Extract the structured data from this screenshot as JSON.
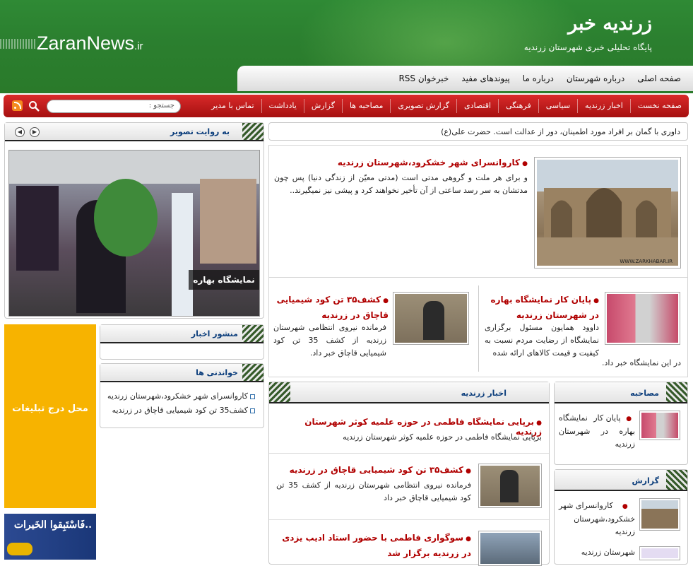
{
  "header": {
    "brand_fa": "زرندیه خبر",
    "subtitle": "پایگاه تحلیلی خبری شهرستان زرندیه",
    "brand_en": "ZaranNews",
    "brand_en_suffix": ".ir"
  },
  "topnav": [
    "صفحه اصلی",
    "درباره شهرستان",
    "درباره ما",
    "پیوندهای مفید",
    "خبرخوان RSS"
  ],
  "mainmenu": [
    "صفحه نخست",
    "اخبار زرندیه",
    "سیاسی",
    "فرهنگی",
    "اقتصادی",
    "گزارش تصویری",
    "مصاحبه ها",
    "گزارش",
    "یادداشت",
    "تماس با مدیر"
  ],
  "search": {
    "placeholder": "جستجو :"
  },
  "quote": "داوری با گمان بر افراد مورد اطمینان، دور از عدالت است. حضرت علی(ع)",
  "featured": {
    "title": "کاروانسرای شهر خشکرود،شهرستان زرندیه",
    "body": "و برای هر ملت و گروهی مدتی است (مدتی معیّن از زندگی دنیا) پس چون مدتشان به سر رسد ساعتی از آن تأخیر نخواهند کرد و پیشی نیز نمیگیرند..",
    "img_caption": "WWW.ZARKHABAR.IR"
  },
  "news_a": {
    "title": "پایان کار نمایشگاه بهاره در شهرستان زرندیه",
    "body": "داوود همایون مسئول برگزاری نمایشگاه از رضایت مردم نسبت به کیفیت و قیمت کالاهای ارائه شده",
    "body2": "در این نمایشگاه خبر داد."
  },
  "news_b": {
    "title": "کشف۳۵ تن کود شیمیایی قاچاق در زرندیه",
    "body": "فرمانده نیروی انتظامی شهرستان زرندیه از کشف 35 تن کود شیمیایی قاچاق خبر داد."
  },
  "gallery": {
    "title": "به روایت تصویر",
    "caption": "نمایشگاه بهاره"
  },
  "ad": {
    "text": "محل درج تبلیغات",
    "text2": "فَاسْتَبِقوا الخَیرات.."
  },
  "manshur": {
    "title": "منشور اخبار"
  },
  "popular": {
    "title": "خواندنی ها",
    "items": [
      "کاروانسرای شهر خشکرود،شهرستان زرندیه",
      "کشف35 تن کود شیمیایی قاچاق در زرندیه"
    ]
  },
  "zarandieh_news": {
    "title": "اخبار زرندیه",
    "items": [
      {
        "title": "برپایی نمایشگاه فاطمی در حوزه علمیه کوثر شهرستان زرندیه",
        "body": "برپایی نمایشگاه فاطمی در حوزه علمیه کوثر شهرستان زرندیه"
      },
      {
        "title": "کشف۳۵ تن کود شیمیایی قاچاق در زرندیه",
        "body": "فرمانده نیروی انتظامی شهرستان زرندیه از کشف 35 تن کود شیمیایی قاچاق خبر داد"
      },
      {
        "title": "سوگواری فاطمی با حضور استاد ادیب یزدی در زرندیه برگزار شد",
        "body": ""
      }
    ]
  },
  "interview": {
    "title": "مصاحبه",
    "item": "پایان کار نمایشگاه بهاره در شهرستان زرندیه"
  },
  "report": {
    "title": "گزارش",
    "item": "کاروانسرای شهر خشکرود،شهرستان زرندیه",
    "item2": "شهرستان زرندیه"
  },
  "colors": {
    "header_green": "#2b7f2f",
    "menu_red": "#c21c1c",
    "title_red": "#b00000",
    "heading_blue": "#0c3e7c",
    "ad_yellow": "#f7b300"
  }
}
